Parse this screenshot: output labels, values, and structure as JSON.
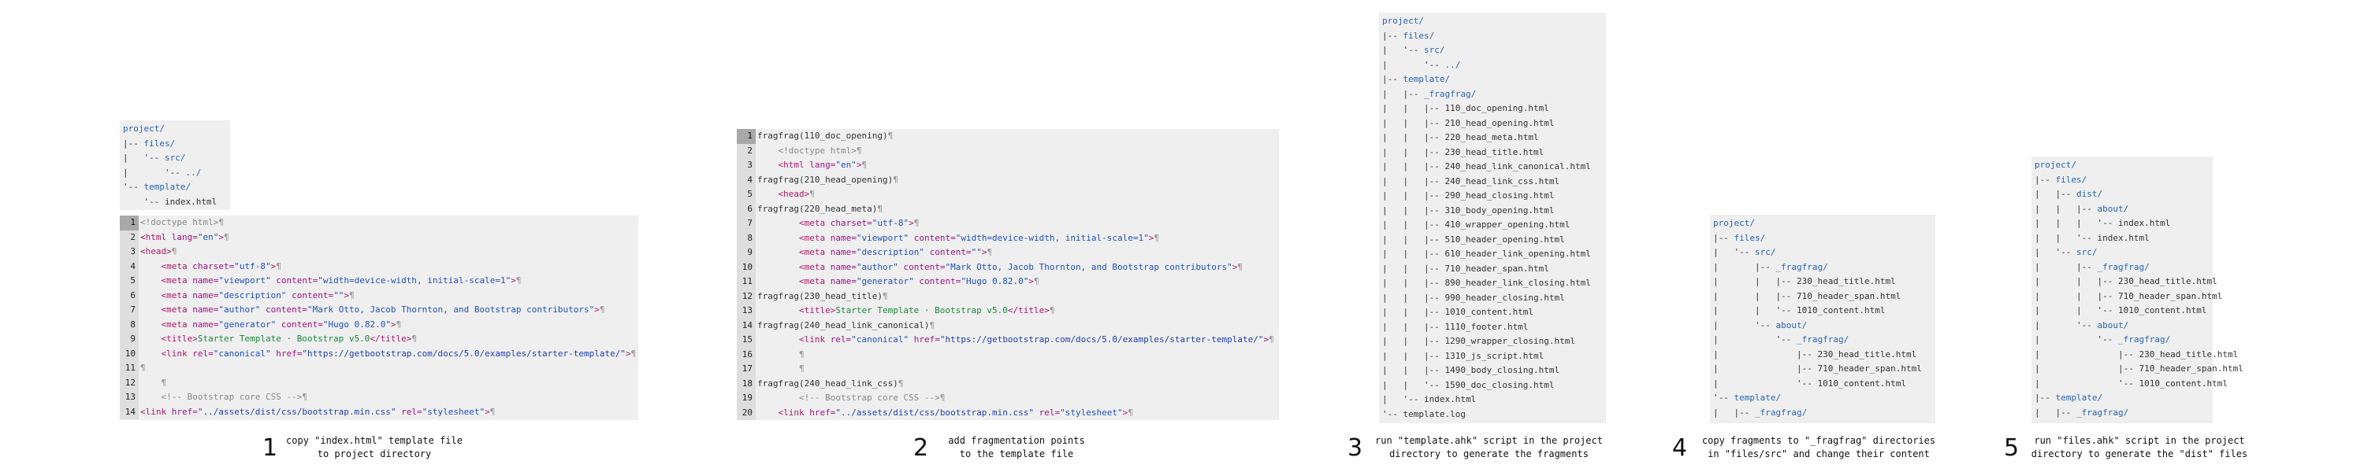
{
  "steps": [
    {
      "number": "1",
      "caption": [
        "copy \"index.html\" template file",
        "to project directory"
      ]
    },
    {
      "number": "2",
      "caption": [
        "add fragmentation points",
        "to the template file"
      ]
    },
    {
      "number": "3",
      "caption": [
        "run \"template.ahk\" script in the project",
        "directory to generate the fragments"
      ]
    },
    {
      "number": "4",
      "caption": [
        "copy fragments to \"_fragfrag\" directories",
        "in \"files/src\" and change their content"
      ]
    },
    {
      "number": "5",
      "caption": [
        "run \"files.ahk\" script in the project",
        "directory to generate the \"dist\" files"
      ]
    }
  ],
  "tree1": [
    [
      [
        "project/",
        "dir"
      ]
    ],
    [
      [
        "|-- ",
        ""
      ],
      [
        "files/",
        "dir"
      ]
    ],
    [
      [
        "|   '-- ",
        ""
      ],
      [
        "src/",
        "dir"
      ]
    ],
    [
      [
        "|       '-- ",
        ""
      ],
      [
        "../",
        "dir"
      ]
    ],
    [
      [
        "'-- ",
        ""
      ],
      [
        "template/",
        "dir"
      ]
    ],
    [
      [
        "    '-- index.html",
        ""
      ]
    ]
  ],
  "code1": [
    [
      [
        "<!doctype html>",
        "doc"
      ],
      [
        "¶",
        "mk"
      ]
    ],
    [
      [
        "<html ",
        "tag"
      ],
      [
        "lang=",
        "attr"
      ],
      [
        "\"en\"",
        "str"
      ],
      [
        ">",
        "tag"
      ],
      [
        "¶",
        "mk"
      ]
    ],
    [
      [
        "<head>",
        "tag"
      ],
      [
        "¶",
        "mk"
      ]
    ],
    [
      [
        "    ",
        ""
      ],
      [
        "<meta ",
        "tag"
      ],
      [
        "charset=",
        "attr"
      ],
      [
        "\"utf-8\"",
        "str"
      ],
      [
        ">",
        "tag"
      ],
      [
        "¶",
        "mk"
      ]
    ],
    [
      [
        "    ",
        ""
      ],
      [
        "<meta ",
        "tag"
      ],
      [
        "name=",
        "attr"
      ],
      [
        "\"viewport\" ",
        "str"
      ],
      [
        "content=",
        "attr"
      ],
      [
        "\"width=device-width, initial-scale=1\"",
        "str"
      ],
      [
        ">",
        "tag"
      ],
      [
        "¶",
        "mk"
      ]
    ],
    [
      [
        "    ",
        ""
      ],
      [
        "<meta ",
        "tag"
      ],
      [
        "name=",
        "attr"
      ],
      [
        "\"description\" ",
        "str"
      ],
      [
        "content=",
        "attr"
      ],
      [
        "\"\"",
        "str"
      ],
      [
        ">",
        "tag"
      ],
      [
        "¶",
        "mk"
      ]
    ],
    [
      [
        "    ",
        ""
      ],
      [
        "<meta ",
        "tag"
      ],
      [
        "name=",
        "attr"
      ],
      [
        "\"author\" ",
        "str"
      ],
      [
        "content=",
        "attr"
      ],
      [
        "\"Mark Otto, Jacob Thornton, and Bootstrap contributors\"",
        "str"
      ],
      [
        ">",
        "tag"
      ],
      [
        "¶",
        "mk"
      ]
    ],
    [
      [
        "    ",
        ""
      ],
      [
        "<meta ",
        "tag"
      ],
      [
        "name=",
        "attr"
      ],
      [
        "\"generator\" ",
        "str"
      ],
      [
        "content=",
        "attr"
      ],
      [
        "\"Hugo 0.82.0\"",
        "str"
      ],
      [
        ">",
        "tag"
      ],
      [
        "¶",
        "mk"
      ]
    ],
    [
      [
        "    ",
        ""
      ],
      [
        "<title>",
        "tag"
      ],
      [
        "Starter Template · Bootstrap v5.0",
        "txtc"
      ],
      [
        "</title>",
        "tag"
      ],
      [
        "¶",
        "mk"
      ]
    ],
    [
      [
        "    ",
        ""
      ],
      [
        "<link ",
        "tag"
      ],
      [
        "rel=",
        "attr"
      ],
      [
        "\"canonical\" ",
        "str"
      ],
      [
        "href=",
        "attr"
      ],
      [
        "\"https://getbootstrap.com/docs/5.0/examples/starter-template/\"",
        "lnk"
      ],
      [
        ">",
        "tag"
      ],
      [
        "¶",
        "mk"
      ]
    ],
    [
      [
        "¶",
        "mk"
      ]
    ],
    [
      [
        "    ",
        ""
      ],
      [
        "¶",
        "mk"
      ]
    ],
    [
      [
        "    ",
        ""
      ],
      [
        "<!-- Bootstrap core CSS -->",
        "cmt"
      ],
      [
        "¶",
        "mk"
      ]
    ],
    [
      [
        "<link ",
        "tag"
      ],
      [
        "href=",
        "attr"
      ],
      [
        "\"../assets/dist/css/bootstrap.min.css\" ",
        "lnk"
      ],
      [
        "rel=",
        "attr"
      ],
      [
        "\"stylesheet\"",
        "str"
      ],
      [
        ">",
        "tag"
      ],
      [
        "¶",
        "mk"
      ]
    ]
  ],
  "code2": [
    [
      [
        "fragfrag(110_doc_opening)",
        "frag"
      ],
      [
        "¶",
        "mk"
      ]
    ],
    [
      [
        "    ",
        ""
      ],
      [
        "<!doctype html>",
        "doc"
      ],
      [
        "¶",
        "mk"
      ]
    ],
    [
      [
        "    ",
        ""
      ],
      [
        "<html ",
        "tag"
      ],
      [
        "lang=",
        "attr"
      ],
      [
        "\"en\"",
        "str"
      ],
      [
        ">",
        "tag"
      ],
      [
        "¶",
        "mk"
      ]
    ],
    [
      [
        "fragfrag(210_head_opening)",
        "frag"
      ],
      [
        "¶",
        "mk"
      ]
    ],
    [
      [
        "    ",
        ""
      ],
      [
        "<head>",
        "tag"
      ],
      [
        "¶",
        "mk"
      ]
    ],
    [
      [
        "fragfrag(220_head_meta)",
        "frag"
      ],
      [
        "¶",
        "mk"
      ]
    ],
    [
      [
        "        ",
        ""
      ],
      [
        "<meta ",
        "tag"
      ],
      [
        "charset=",
        "attr"
      ],
      [
        "\"utf-8\"",
        "str"
      ],
      [
        ">",
        "tag"
      ],
      [
        "¶",
        "mk"
      ]
    ],
    [
      [
        "        ",
        ""
      ],
      [
        "<meta ",
        "tag"
      ],
      [
        "name=",
        "attr"
      ],
      [
        "\"viewport\" ",
        "str"
      ],
      [
        "content=",
        "attr"
      ],
      [
        "\"width=device-width, initial-scale=1\"",
        "str"
      ],
      [
        ">",
        "tag"
      ],
      [
        "¶",
        "mk"
      ]
    ],
    [
      [
        "        ",
        ""
      ],
      [
        "<meta ",
        "tag"
      ],
      [
        "name=",
        "attr"
      ],
      [
        "\"description\" ",
        "str"
      ],
      [
        "content=",
        "attr"
      ],
      [
        "\"\"",
        "str"
      ],
      [
        ">",
        "tag"
      ],
      [
        "¶",
        "mk"
      ]
    ],
    [
      [
        "        ",
        ""
      ],
      [
        "<meta ",
        "tag"
      ],
      [
        "name=",
        "attr"
      ],
      [
        "\"author\" ",
        "str"
      ],
      [
        "content=",
        "attr"
      ],
      [
        "\"Mark Otto, Jacob Thornton, and Bootstrap contributors\"",
        "str"
      ],
      [
        ">",
        "tag"
      ],
      [
        "¶",
        "mk"
      ]
    ],
    [
      [
        "        ",
        ""
      ],
      [
        "<meta ",
        "tag"
      ],
      [
        "name=",
        "attr"
      ],
      [
        "\"generator\" ",
        "str"
      ],
      [
        "content=",
        "attr"
      ],
      [
        "\"Hugo 0.82.0\"",
        "str"
      ],
      [
        ">",
        "tag"
      ],
      [
        "¶",
        "mk"
      ]
    ],
    [
      [
        "fragfrag(230_head_title)",
        "frag"
      ],
      [
        "¶",
        "mk"
      ]
    ],
    [
      [
        "        ",
        ""
      ],
      [
        "<title>",
        "tag"
      ],
      [
        "Starter Template · Bootstrap v5.0",
        "txtc"
      ],
      [
        "</title>",
        "tag"
      ],
      [
        "¶",
        "mk"
      ]
    ],
    [
      [
        "fragfrag(240_head_link_canonical)",
        "frag"
      ],
      [
        "¶",
        "mk"
      ]
    ],
    [
      [
        "        ",
        ""
      ],
      [
        "<link ",
        "tag"
      ],
      [
        "rel=",
        "attr"
      ],
      [
        "\"canonical\" ",
        "str"
      ],
      [
        "href=",
        "attr"
      ],
      [
        "\"https://getbootstrap.com/docs/5.0/examples/starter-template/\"",
        "lnk"
      ],
      [
        ">",
        "tag"
      ],
      [
        "¶",
        "mk"
      ]
    ],
    [
      [
        "        ",
        ""
      ],
      [
        "¶",
        "mk"
      ]
    ],
    [
      [
        "        ",
        ""
      ],
      [
        "¶",
        "mk"
      ]
    ],
    [
      [
        "fragfrag(240_head_link_css)",
        "frag"
      ],
      [
        "¶",
        "mk"
      ]
    ],
    [
      [
        "        ",
        ""
      ],
      [
        "<!-- Bootstrap core CSS -->",
        "cmt"
      ],
      [
        "¶",
        "mk"
      ]
    ],
    [
      [
        "    ",
        ""
      ],
      [
        "<link ",
        "tag"
      ],
      [
        "href=",
        "attr"
      ],
      [
        "\"../assets/dist/css/bootstrap.min.css\" ",
        "lnk"
      ],
      [
        "rel=",
        "attr"
      ],
      [
        "\"stylesheet\"",
        "str"
      ],
      [
        ">",
        "tag"
      ],
      [
        "¶",
        "mk"
      ]
    ]
  ],
  "tree3": [
    [
      [
        "project/",
        "dir"
      ]
    ],
    [
      [
        "|-- ",
        ""
      ],
      [
        "files/",
        "dir"
      ]
    ],
    [
      [
        "|   '-- ",
        ""
      ],
      [
        "src/",
        "dir"
      ]
    ],
    [
      [
        "|       '-- ",
        ""
      ],
      [
        "../",
        "dir"
      ]
    ],
    [
      [
        "|-- ",
        ""
      ],
      [
        "template/",
        "dir"
      ]
    ],
    [
      [
        "|   |-- ",
        ""
      ],
      [
        "_fragfrag/",
        "dir"
      ]
    ],
    [
      [
        "|   |   |-- 110_doc_opening.html",
        ""
      ]
    ],
    [
      [
        "|   |   |-- 210_head_opening.html",
        ""
      ]
    ],
    [
      [
        "|   |   |-- 220_head_meta.html",
        ""
      ]
    ],
    [
      [
        "|   |   |-- 230_head_title.html",
        ""
      ]
    ],
    [
      [
        "|   |   |-- 240_head_link_canonical.html",
        ""
      ]
    ],
    [
      [
        "|   |   |-- 240_head_link_css.html",
        ""
      ]
    ],
    [
      [
        "|   |   |-- 290_head_closing.html",
        ""
      ]
    ],
    [
      [
        "|   |   |-- 310_body_opening.html",
        ""
      ]
    ],
    [
      [
        "|   |   |-- 410_wrapper_opening.html",
        ""
      ]
    ],
    [
      [
        "|   |   |-- 510_header_opening.html",
        ""
      ]
    ],
    [
      [
        "|   |   |-- 610_header_link_opening.html",
        ""
      ]
    ],
    [
      [
        "|   |   |-- 710_header_span.html",
        ""
      ]
    ],
    [
      [
        "|   |   |-- 890_header_link_closing.html",
        ""
      ]
    ],
    [
      [
        "|   |   |-- 990_header_closing.html",
        ""
      ]
    ],
    [
      [
        "|   |   |-- 1010_content.html",
        ""
      ]
    ],
    [
      [
        "|   |   |-- 1110_footer.html",
        ""
      ]
    ],
    [
      [
        "|   |   |-- 1290_wrapper_closing.html",
        ""
      ]
    ],
    [
      [
        "|   |   |-- 1310_js_script.html",
        ""
      ]
    ],
    [
      [
        "|   |   |-- 1490_body_closing.html",
        ""
      ]
    ],
    [
      [
        "|   |   '-- 1590_doc_closing.html",
        ""
      ]
    ],
    [
      [
        "|   '-- index.html",
        ""
      ]
    ],
    [
      [
        "'-- template.log",
        ""
      ]
    ]
  ],
  "tree4": [
    [
      [
        "project/",
        "dir"
      ]
    ],
    [
      [
        "|-- ",
        ""
      ],
      [
        "files/",
        "dir"
      ]
    ],
    [
      [
        "|   '-- ",
        ""
      ],
      [
        "src/",
        "dir"
      ]
    ],
    [
      [
        "|       |-- ",
        ""
      ],
      [
        "_fragfrag/",
        "dir"
      ]
    ],
    [
      [
        "|       |   |-- 230_head_title.html",
        ""
      ]
    ],
    [
      [
        "|       |   |-- 710_header_span.html",
        ""
      ]
    ],
    [
      [
        "|       |   '-- 1010_content.html",
        ""
      ]
    ],
    [
      [
        "|       '-- ",
        ""
      ],
      [
        "about/",
        "dir"
      ]
    ],
    [
      [
        "|           '-- ",
        ""
      ],
      [
        "_fragfrag/",
        "dir"
      ]
    ],
    [
      [
        "|               |-- 230_head_title.html",
        ""
      ]
    ],
    [
      [
        "|               |-- 710_header_span.html",
        ""
      ]
    ],
    [
      [
        "|               '-- 1010_content.html",
        ""
      ]
    ],
    [
      [
        "'-- ",
        ""
      ],
      [
        "template/",
        "dir"
      ]
    ],
    [
      [
        "|   |-- ",
        ""
      ],
      [
        "_fragfrag/",
        "dir"
      ]
    ]
  ],
  "tree5": [
    [
      [
        "project/",
        "dir"
      ]
    ],
    [
      [
        "|-- ",
        ""
      ],
      [
        "files/",
        "dir"
      ]
    ],
    [
      [
        "|   |-- ",
        ""
      ],
      [
        "dist/",
        "dir"
      ]
    ],
    [
      [
        "|   |   |-- ",
        ""
      ],
      [
        "about/",
        "dir"
      ]
    ],
    [
      [
        "|   |   |   '-- index.html",
        ""
      ]
    ],
    [
      [
        "|   |   '-- index.html",
        ""
      ]
    ],
    [
      [
        "|   '-- ",
        ""
      ],
      [
        "src/",
        "dir"
      ]
    ],
    [
      [
        "|       |-- ",
        ""
      ],
      [
        "_fragfrag/",
        "dir"
      ]
    ],
    [
      [
        "|       |   |-- 230_head_title.html",
        ""
      ]
    ],
    [
      [
        "|       |   |-- 710_header_span.html",
        ""
      ]
    ],
    [
      [
        "|       |   '-- 1010_content.html",
        ""
      ]
    ],
    [
      [
        "|       '-- ",
        ""
      ],
      [
        "about/",
        "dir"
      ]
    ],
    [
      [
        "|           '-- ",
        ""
      ],
      [
        "_fragfrag/",
        "dir"
      ]
    ],
    [
      [
        "|               |-- 230_head_title.html",
        ""
      ]
    ],
    [
      [
        "|               |-- 710_header_span.html",
        ""
      ]
    ],
    [
      [
        "|               '-- 1010_content.html",
        ""
      ]
    ],
    [
      [
        "|-- ",
        ""
      ],
      [
        "template/",
        "dir"
      ]
    ],
    [
      [
        "|   |-- ",
        ""
      ],
      [
        "_fragfrag/",
        "dir"
      ]
    ]
  ]
}
